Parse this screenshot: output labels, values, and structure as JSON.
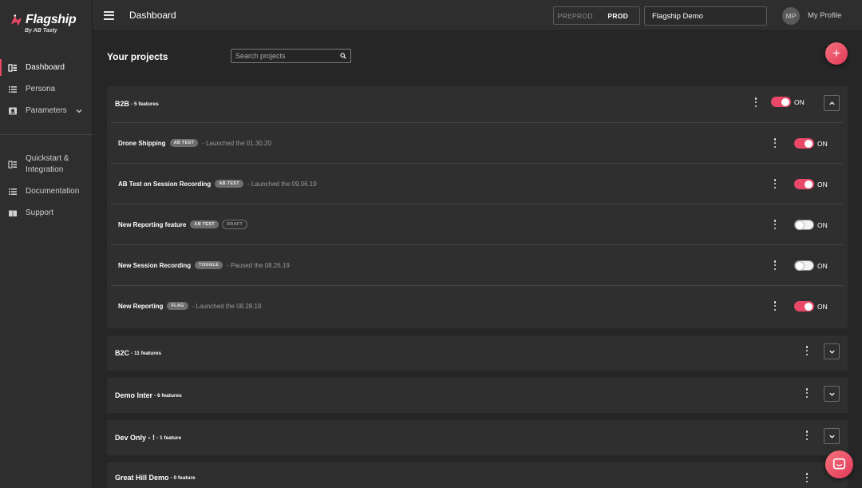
{
  "brand": {
    "name": "Flagship",
    "sub": "By AB Tasty",
    "accent": "#e94868"
  },
  "sidebar": {
    "items": [
      {
        "label": "Dashboard",
        "icon": "dashboard-icon",
        "active": true
      },
      {
        "label": "Persona",
        "icon": "list-icon"
      },
      {
        "label": "Parameters",
        "icon": "parameters-icon",
        "expandable": true
      },
      {
        "label": "Quickstart & Integration",
        "icon": "book-icon"
      },
      {
        "label": "Documentation",
        "icon": "list-icon"
      },
      {
        "label": "Support",
        "icon": "support-icon"
      }
    ]
  },
  "topbar": {
    "title": "Dashboard",
    "env": {
      "preprod": "PREPROD",
      "prod": "PROD",
      "selected": "PROD"
    },
    "project": "Flagship Demo",
    "avatar_initials": "MP",
    "profile_label": "My Profile"
  },
  "main": {
    "title": "Your projects",
    "search_placeholder": "Search projects",
    "add_label": "+"
  },
  "projects": [
    {
      "name": "B2B",
      "count": "- 5 features",
      "expanded": true,
      "toggle": {
        "state": "on",
        "label": "ON"
      },
      "features": [
        {
          "name": "Drone Shipping",
          "badges": [
            "AB TEST"
          ],
          "meta": "- Launched the 01.30.20",
          "toggle": "on",
          "toggle_label": "ON"
        },
        {
          "name": "AB Test on Session Recording",
          "badges": [
            "AB TEST"
          ],
          "meta": "- Launched the 09.06.19",
          "toggle": "on",
          "toggle_label": "ON"
        },
        {
          "name": "New Reporting feature",
          "badges": [
            "AB TEST"
          ],
          "draft": "DRAFT",
          "meta": "",
          "toggle": "off",
          "toggle_label": "ON"
        },
        {
          "name": "New Session Recording",
          "badges": [
            "TOGGLE"
          ],
          "meta": "- Paused the 08.26.19",
          "toggle": "off",
          "toggle_label": "ON"
        },
        {
          "name": "New Reporting",
          "badges": [
            "FLAG"
          ],
          "meta": "- Launched the 08.28.19",
          "toggle": "on",
          "toggle_label": "ON"
        }
      ]
    },
    {
      "name": "B2C",
      "count": "- 11 features",
      "expanded": false
    },
    {
      "name": "Demo Inter",
      "count": "- 6 features",
      "expanded": false
    },
    {
      "name": "Dev Only - !",
      "count": "- 1 feature",
      "expanded": false
    },
    {
      "name": "Great Hill Demo",
      "count": "- 0 feature",
      "expanded": false
    }
  ]
}
